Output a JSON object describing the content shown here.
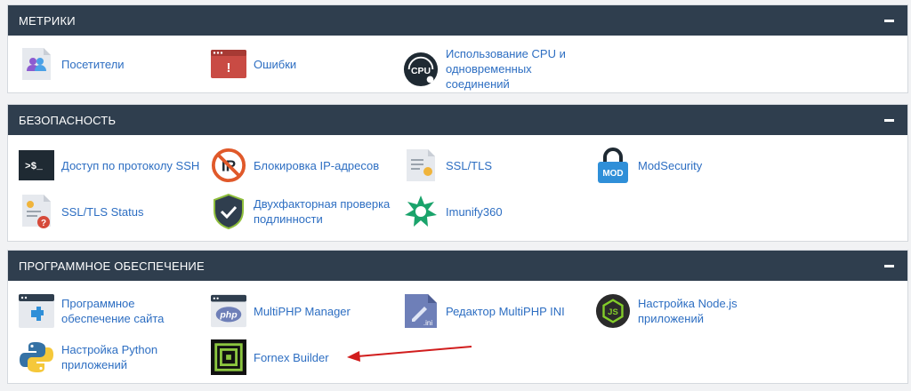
{
  "colors": {
    "header_bg": "#2f3e4e",
    "link": "#2d6ec2",
    "arrow": "#d11d1d"
  },
  "sections": {
    "metrics": {
      "title": "МЕТРИКИ",
      "items": [
        {
          "label": "Посетители",
          "icon": "visitors-icon"
        },
        {
          "label": "Ошибки",
          "icon": "errors-icon"
        },
        {
          "label": "Использование CPU и одновременных соединений",
          "icon": "cpu-icon"
        }
      ]
    },
    "security": {
      "title": "БЕЗОПАСНОСТЬ",
      "items": [
        {
          "label": "Доступ по протоколу SSH",
          "icon": "ssh-terminal-icon"
        },
        {
          "label": "Блокировка IP-адресов",
          "icon": "ip-block-icon"
        },
        {
          "label": "SSL/TLS",
          "icon": "ssl-certificate-icon"
        },
        {
          "label": "ModSecurity",
          "icon": "modsecurity-lock-icon"
        },
        {
          "label": "SSL/TLS Status",
          "icon": "ssl-status-icon"
        },
        {
          "label": "Двухфакторная проверка подлинности",
          "icon": "two-factor-shield-icon"
        },
        {
          "label": "Imunify360",
          "icon": "imunify360-icon"
        }
      ]
    },
    "software": {
      "title": "ПРОГРАММНОЕ ОБЕСПЕЧЕНИЕ",
      "items": [
        {
          "label": "Программное обеспечение сайта",
          "icon": "site-software-icon"
        },
        {
          "label": "MultiPHP Manager",
          "icon": "php-icon"
        },
        {
          "label": "Редактор MultiPHP INI",
          "icon": "ini-file-icon"
        },
        {
          "label": "Настройка Node.js приложений",
          "icon": "nodejs-icon"
        },
        {
          "label": "Настройка Python приложений",
          "icon": "python-icon"
        },
        {
          "label": "Fornex Builder",
          "icon": "fornex-builder-icon"
        }
      ]
    }
  }
}
